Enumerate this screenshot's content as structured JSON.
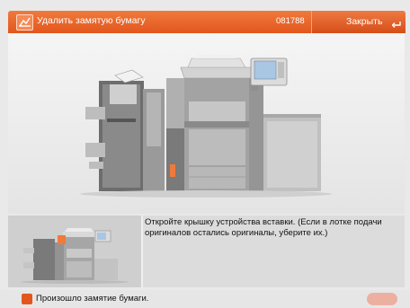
{
  "header": {
    "title": "Удалить замятую бумагу",
    "code": "081788",
    "close_label": "Закрыть",
    "icon": "paper-jam-icon",
    "accent_color": "#e2561e"
  },
  "instruction": {
    "text": "Откройте крышку устройства вставки. (Если в лотке подачи оригиналов остались оригиналы, уберите их.)"
  },
  "status_bar": {
    "message": "Произошло замятие бумаги.",
    "icon": "error-icon"
  },
  "icons": {
    "enter": "enter-return-icon",
    "machine": "printer-machine-illustration",
    "thumbnail": "printer-thumbnail-illustration"
  }
}
